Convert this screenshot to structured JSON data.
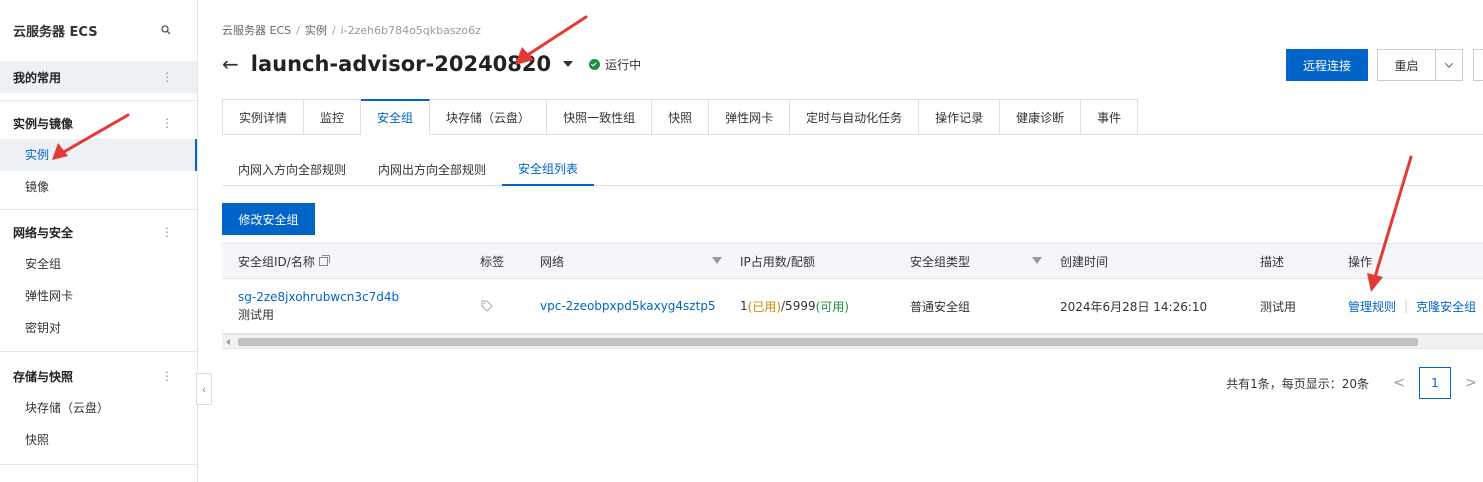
{
  "sidebar": {
    "title": "云服务器 ECS",
    "pinned_group": "我的常用",
    "groups": [
      {
        "label": "实例与镜像",
        "items": [
          "实例",
          "镜像"
        ]
      },
      {
        "label": "网络与安全",
        "items": [
          "安全组",
          "弹性网卡",
          "密钥对"
        ]
      },
      {
        "label": "存储与快照",
        "items": [
          "块存储（云盘）",
          "快照"
        ]
      }
    ],
    "active_item": "实例",
    "more_glyph": "⋮",
    "collapse_glyph": "‹"
  },
  "breadcrumb": [
    "云服务器 ECS",
    "实例",
    "i-2zeh6b784o5qkbaszo6z"
  ],
  "header": {
    "back_glyph": "←",
    "instance_name": "launch-advisor-20240820",
    "status": "运行中",
    "status_color": "#1e8e3e",
    "remote_connect": "远程连接",
    "restart": "重启"
  },
  "tabs": [
    "实例详情",
    "监控",
    "安全组",
    "块存储（云盘）",
    "快照一致性组",
    "快照",
    "弹性网卡",
    "定时与自动化任务",
    "操作记录",
    "健康诊断",
    "事件"
  ],
  "active_tab": "安全组",
  "subtabs": [
    "内网入方向全部规则",
    "内网出方向全部规则",
    "安全组列表"
  ],
  "active_subtab": "安全组列表",
  "modify_button": "修改安全组",
  "table": {
    "headers": {
      "id_name": "安全组ID/名称",
      "tags": "标签",
      "network": "网络",
      "ip_quota": "IP占用数/配额",
      "sg_type": "安全组类型",
      "created": "创建时间",
      "desc": "描述",
      "ops": "操作"
    },
    "rows": [
      {
        "id": "sg-2ze8jxohrubwcn3c7d4b",
        "name": "测试用",
        "network": "vpc-2zeobpxpd5kaxyg4sztp5",
        "ip_count": "1",
        "used_label": "(已用)",
        "quota": "/5999",
        "avail_label": "(可用)",
        "sg_type": "普通安全组",
        "created": "2024年6月28日 14:26:10",
        "desc": "测试用",
        "op_manage": "管理规则",
        "op_sep": "|",
        "op_clone": "克隆安全组"
      }
    ]
  },
  "pagination": {
    "summary": "共有1条，每页显示：20条",
    "current_page": "1",
    "prev_glyph": "<",
    "next_glyph": ">"
  },
  "colors": {
    "accent": "#0064c8",
    "annotation_arrow": "#e53935"
  }
}
